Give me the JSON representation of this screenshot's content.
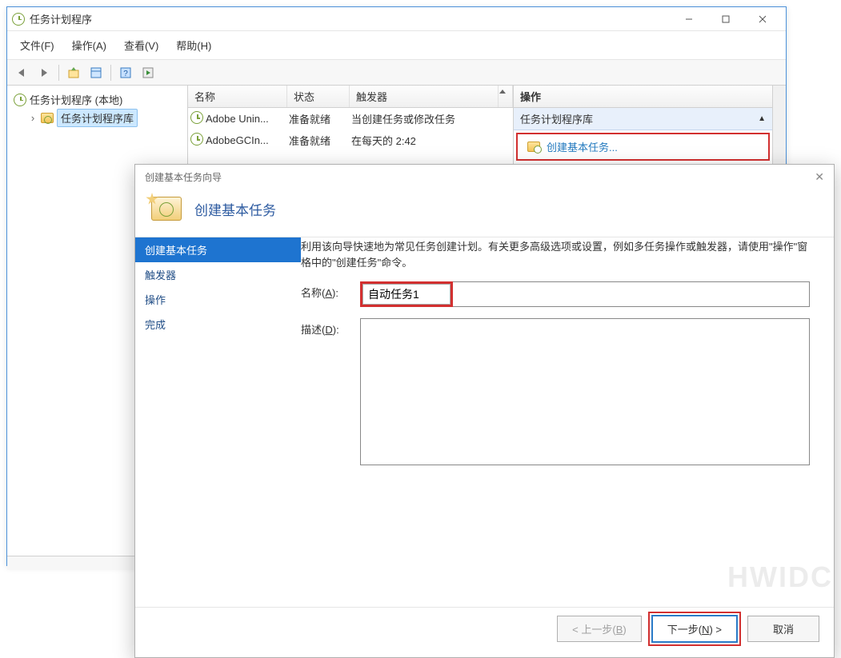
{
  "mainWindow": {
    "title": "任务计划程序",
    "menu": {
      "file": "文件(F)",
      "action": "操作(A)",
      "view": "查看(V)",
      "help": "帮助(H)"
    },
    "tree": {
      "root": "任务计划程序 (本地)",
      "child": "任务计划程序库"
    },
    "listHeaders": {
      "name": "名称",
      "status": "状态",
      "trigger": "触发器"
    },
    "tasks": [
      {
        "name": "Adobe Unin...",
        "status": "准备就绪",
        "trigger": "当创建任务或修改任务"
      },
      {
        "name": "AdobeGCIn...",
        "status": "准备就绪",
        "trigger": "在每天的 2:42"
      }
    ],
    "actions": {
      "header": "操作",
      "section": "任务计划程序库",
      "createBasic": "创建基本任务..."
    }
  },
  "wizard": {
    "title": "创建基本任务向导",
    "heading": "创建基本任务",
    "steps": {
      "basic": "创建基本任务",
      "trigger": "触发器",
      "action": "操作",
      "finish": "完成"
    },
    "description": "利用该向导快速地为常见任务创建计划。有关更多高级选项或设置，例如多任务操作或触发器，请使用\"操作\"窗格中的\"创建任务\"命令。",
    "form": {
      "nameLabel": "名称(",
      "nameHotkey": "A",
      "nameLabelEnd": "):",
      "nameValue": "自动任务1",
      "descLabel": "描述(",
      "descHotkey": "D",
      "descLabelEnd": "):",
      "descValue": ""
    },
    "buttons": {
      "backPrefix": "< 上一步(",
      "backHotkey": "B",
      "backSuffix": ")",
      "nextPrefix": "下一步(",
      "nextHotkey": "N",
      "nextSuffix": ") >",
      "cancel": "取消"
    }
  },
  "watermark": "HWIDC"
}
